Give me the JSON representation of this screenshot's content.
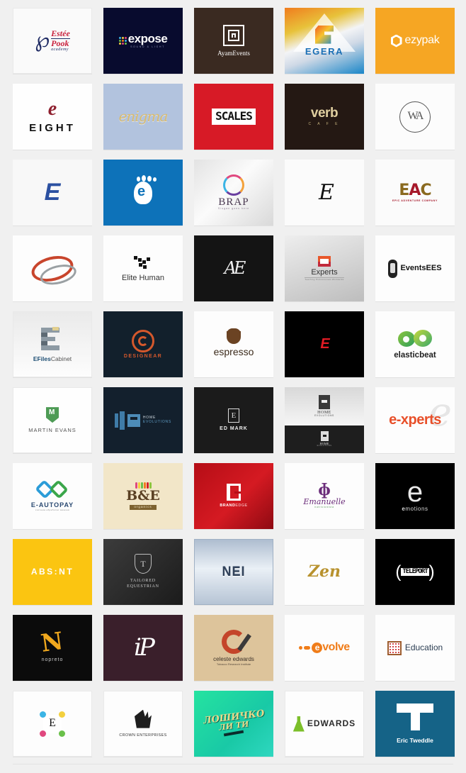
{
  "page": {
    "type": "logo-inspiration-grid",
    "columns": 5,
    "rows": 10,
    "background": "#f0f0f0"
  },
  "tiles": [
    {
      "id": "estee-pook",
      "title": "Estée Pook academy",
      "line1": "Estée",
      "line2": "Pook",
      "line3": "academy",
      "glyph": "℘",
      "bg": "#fafafa",
      "accent": "#c9203c",
      "accent2": "#1f2b64"
    },
    {
      "id": "expose",
      "title": "expose",
      "word": "expose",
      "sub": "SOUND & LIGHT",
      "bg": "#080b2e",
      "accent": "#ffffff"
    },
    {
      "id": "ayam-events",
      "title": "AyamEvents",
      "word": "AyamEvents",
      "bg": "#3a2a21",
      "accent": "#ffffff"
    },
    {
      "id": "egera",
      "title": "EGERA",
      "word": "EGERA",
      "bg": "#f3f4f6",
      "accent": "#1a6fb5"
    },
    {
      "id": "ezypak",
      "title": "ezypak",
      "word": "ezypak",
      "bg": "#f6a623",
      "accent": "#ffffff"
    },
    {
      "id": "eight",
      "title": "EIGHT",
      "word": "EIGHT",
      "mark": "e",
      "bg": "#fefefe",
      "accent": "#8e1f2e"
    },
    {
      "id": "enigma",
      "title": "enigma",
      "word": "enigma",
      "bg": "#b2c3de",
      "accent": "#d9bb6e"
    },
    {
      "id": "scales",
      "title": "SCALES",
      "word": "SCALES",
      "bg": "#d71a26",
      "accent": "#ffffff"
    },
    {
      "id": "verb-cafe",
      "title": "verb cafe",
      "word": "verb",
      "sub": "C A F E",
      "bg": "#241813",
      "accent": "#e0cfa0"
    },
    {
      "id": "wa-monogram",
      "title": "WA monogram",
      "word": "WA",
      "bg": "#fcfcfc",
      "accent": "#555555"
    },
    {
      "id": "e-blue-mark",
      "title": "E mark blue",
      "word": "E",
      "bg": "#f8f8f8",
      "accent": "#2b50a1"
    },
    {
      "id": "e-footprint",
      "title": "e footprint",
      "word": "e",
      "bg": "#0d72b9",
      "accent": "#ffffff"
    },
    {
      "id": "brap",
      "title": "BRAP",
      "word": "BRAP",
      "sub": "Slogan goes here",
      "bg": "#efefef",
      "accent": "#4b3a52"
    },
    {
      "id": "e-script-mono",
      "title": "E script monogram",
      "word": "E",
      "bg": "#fbfbfb",
      "accent": "#111111"
    },
    {
      "id": "eac",
      "title": "EAC Epic Adventure Company",
      "word": "EAC",
      "sub": "EPIC ADVENTURE COMPANY",
      "bg": "#fbfbfb",
      "accent": "#a6182a"
    },
    {
      "id": "swoosh-oval",
      "title": "swoosh oval mark",
      "bg": "#fdfdfd",
      "accent": "#c8452c"
    },
    {
      "id": "elite-human",
      "title": "Elite Human",
      "word": "Elite Human",
      "bg": "#fdfdfd",
      "accent": "#333333"
    },
    {
      "id": "ae-script-dark",
      "title": "AE script dark",
      "word": "AE",
      "bg": "#141414",
      "accent": "#eeeeee"
    },
    {
      "id": "experts",
      "title": "Experts",
      "word": "Experts",
      "sub": "Teaching Professionals  Worldwide",
      "bg": "#d8d8d8",
      "accent": "#e8572a"
    },
    {
      "id": "events-ees",
      "title": "EventsEES",
      "word": "EventsEES",
      "bg": "#fdfdfd",
      "accent": "#111111"
    },
    {
      "id": "efiles-cabinet",
      "title": "EFilesCabinet",
      "word1": "EFiles",
      "word2": "Cabinet",
      "bg": "#eeeeee",
      "accent": "#1d4e73"
    },
    {
      "id": "designear",
      "title": "DESIGNEAR",
      "word": "DESIGNEAR",
      "bg": "#12202c",
      "accent": "#d4582c"
    },
    {
      "id": "espresso",
      "title": "espresso",
      "word": "espresso",
      "bg": "#fdfdfd",
      "accent": "#6b4323"
    },
    {
      "id": "e-red-black",
      "title": "E red on black",
      "word": "E",
      "bg": "#000000",
      "accent": "#e01b24"
    },
    {
      "id": "elasticbeat",
      "title": "elasticbeat",
      "word": "elasticbeat",
      "bg": "#fdfdfd",
      "accent": "#8cc63e"
    },
    {
      "id": "martin-evans",
      "title": "MARTIN EVANS",
      "word": "MARTIN EVANS",
      "bg": "#fefefe",
      "accent": "#4e9b55"
    },
    {
      "id": "home-evolutions-1",
      "title": "HOME EVOLUTIONS",
      "word1": "HOME",
      "word2": "EVOLUTIONS",
      "bg": "#13202d",
      "accent": "#4d8cb8"
    },
    {
      "id": "ed-mark",
      "title": "ED MARK",
      "word": "ED MARK",
      "mark": "E",
      "bg": "#1b1b1b",
      "accent": "#eeeeee"
    },
    {
      "id": "home-evolutions-2",
      "title": "Home Evolutions",
      "word1": "HOME",
      "word2": "EVOLUTIONS",
      "word3": "HOME",
      "word4": "EVOLUTIONS",
      "bg": "#e6e6e6",
      "accent": "#1e1e1e"
    },
    {
      "id": "e-xperts",
      "title": "e-xperts",
      "word": "e-xperts",
      "bg": "#fdfdfd",
      "accent": "#e8502a"
    },
    {
      "id": "e-autopay",
      "title": "E-AUTOPAY",
      "word": "E-AUTOPAY",
      "sub": "система обработки заказов",
      "bg": "#fdfdfd",
      "accent": "#2b9cd8"
    },
    {
      "id": "b-and-e-organics",
      "title": "B&E Organics",
      "word": "B&E",
      "sub": "organics",
      "bg": "#f2e6c8",
      "accent": "#5a4023"
    },
    {
      "id": "brandedge",
      "title": "BRANDEDGE",
      "word1": "BRAND",
      "word2": "EDGE",
      "bg": "#c5121b",
      "accent": "#ffffff"
    },
    {
      "id": "emanuelle",
      "title": "Emanuelle",
      "word": "Emanuelle",
      "sub": "nutricionista",
      "bg": "#fdfdfd",
      "accent": "#6b2d7a"
    },
    {
      "id": "emotions",
      "title": "emotions",
      "word1": "e",
      "word2": "motions",
      "bg": "#000000",
      "accent": "#e9e9e9"
    },
    {
      "id": "absent",
      "title": "ABSENT",
      "word": "ABS:NT",
      "bg": "#fbc511",
      "accent": "#ffffff"
    },
    {
      "id": "tailored-equestrian",
      "title": "TAILORED EQUESTRIAN",
      "word1": "TAILORED",
      "word2": "EQUESTRIAN",
      "bg": "#2b2b2b",
      "accent": "#cfcfcf"
    },
    {
      "id": "nei",
      "title": "NEI",
      "word": "NEI",
      "bg": "#c3d1e0",
      "accent": "#31425a"
    },
    {
      "id": "zen",
      "title": "Zen",
      "word": "Zen",
      "bg": "#fdfdfd",
      "accent": "#b8922e"
    },
    {
      "id": "teleport",
      "title": "TELEPORT",
      "word": "TELEPORT",
      "bg": "#000000",
      "accent": "#ffffff"
    },
    {
      "id": "nopreto",
      "title": "nopreto",
      "word": "nopreto",
      "mark": "N",
      "bg": "#0b0b0b",
      "accent": "#f0a81e"
    },
    {
      "id": "ip-monogram",
      "title": "iP monogram",
      "word": "iP",
      "bg": "#3a1f2b",
      "accent": "#ffffff"
    },
    {
      "id": "celeste-edwards",
      "title": "celeste edwards",
      "word": "celeste edwards",
      "sub": "Tobacco Research Institute",
      "bg": "#ddc49b",
      "accent": "#c4452a"
    },
    {
      "id": "evolve",
      "title": "evolve",
      "word": "volve",
      "mark": "e",
      "bg": "#fdfdfd",
      "accent": "#f07d1a"
    },
    {
      "id": "education",
      "title": "Education",
      "word": "Education",
      "bg": "#fdfdfd",
      "accent": "#2b3d52"
    },
    {
      "id": "e-colorful-cube",
      "title": "E colorful mark",
      "word": "E",
      "bg": "#fdfdfd",
      "accent": "#111111"
    },
    {
      "id": "crown-enterprises",
      "title": "CROWN ENTERPRISES",
      "word": "CROWN ENTERPRISES",
      "bg": "#fdfdfd",
      "accent": "#1e1e1e"
    },
    {
      "id": "loshadko",
      "title": "ЛОШИЧКО ЛИТИ",
      "word1": "ЛОШИЧКО",
      "word2": "ЛИ ТИ",
      "bg": "#22dca6",
      "accent": "#e9d98a"
    },
    {
      "id": "edwards",
      "title": "EDWARDS",
      "word": "EDWARDS",
      "bg": "#fdfdfd",
      "accent": "#7cbf2a"
    },
    {
      "id": "eric-tweddle",
      "title": "Eric Tweddle",
      "word": "Eric Tweddle",
      "mark": "T",
      "bg": "#156387",
      "accent": "#ffffff"
    }
  ]
}
